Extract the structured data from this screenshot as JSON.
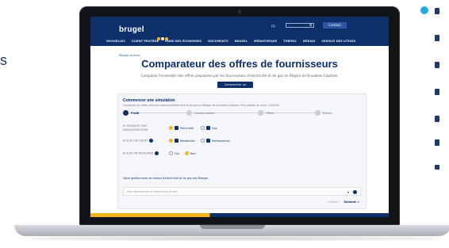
{
  "left_edge_text": "s",
  "site": {
    "logo": "brugel",
    "logo_dot_colors": [
      "#f2b51c",
      "#ffffff",
      "#f2b51c"
    ],
    "lang": "FR",
    "contact_label": "Contact",
    "nav": [
      "NOUVELLES",
      "CLIENT PROTÉGÉ",
      "FAIRE DES ÉCONOMIES",
      "DOCUMENTS",
      "BRUGEL",
      "MÉDIATHÈQUE",
      "THÈMES",
      "MÉDIAS",
      "SERVICE DES LITIGES"
    ]
  },
  "breadcrumb": "Région connue",
  "hero": {
    "title": "Comparateur des offres de fournisseurs",
    "subtitle": "Comparez l'ensemble des offres proposées par les fournisseurs d'électricité et de gaz en Région de Bruxelles-Capitale.",
    "cta_label": "Commencer un simulateur"
  },
  "simulation": {
    "title": "Commencer une simulation",
    "description": "Comparez les offres des fournisseurs d'électricité et de gaz en Région de Bruxelles-Capitale. Prix valable au mois : 10/2024",
    "steps": [
      "Profil",
      "Consommation",
      "Offres",
      "Détails"
    ],
    "questions": {
      "q1": "Je souhaite une simulation pour",
      "q1_options": [
        "Électricité",
        "Gaz"
      ],
      "q2": "Je suis un client",
      "q2_options": [
        "Résidentiel",
        "Professionnel"
      ],
      "q3": "Je suis un prosumer",
      "q3_options": [
        "Oui",
        "Non"
      ]
    },
    "note": "Votre gestionnaire de réseau d'électricité et de gaz est Sibelga.",
    "select_placeholder": "Mon fournisseur d'électricité actuel",
    "prev_label": "< Retour",
    "next_label": "Suivant >"
  },
  "colors": {
    "brand_navy": "#0d2f6a",
    "accent_yellow": "#f2b51c",
    "bullet_blue": "#29a9e1"
  }
}
